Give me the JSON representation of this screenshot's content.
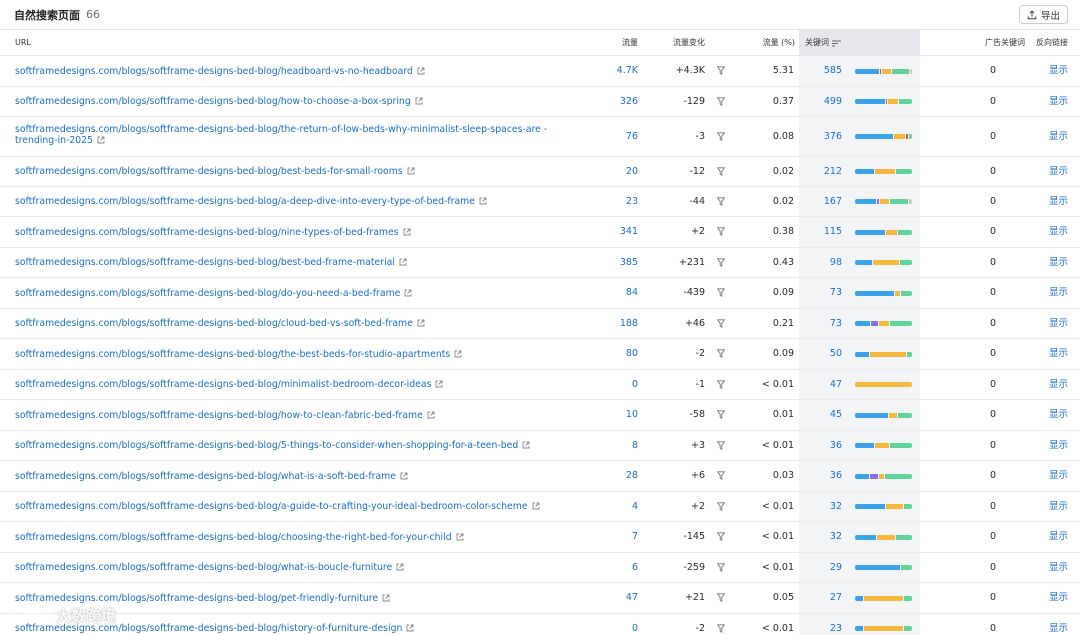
{
  "header": {
    "title": "自然搜索页面",
    "count": "66",
    "export_label": "导出"
  },
  "columns": {
    "url": "URL",
    "traffic": "流量",
    "change": "流量变化",
    "pct": "流量 (%)",
    "keywords": "关键词",
    "ad_keywords": "广告关键词",
    "backlinks": "反向链接"
  },
  "colors": {
    "blue": "#3aa3ea",
    "red": "#e24b4b",
    "orange": "#f4b93e",
    "green": "#5fd39a",
    "purple": "#8d6cf0",
    "gray": "#c8c8c8",
    "link": "#1a6fc4"
  },
  "rows": [
    {
      "url": "softframedesigns.com/blogs/softframe-designs-bed-blog/headboard-vs-no-headboard",
      "traffic": "4.7K",
      "change": "+4.3K",
      "pct": "5.31",
      "keywords": "585",
      "ad_keywords": "0",
      "backlinks": "显示",
      "bar": [
        [
          "blue",
          45
        ],
        [
          "red",
          3
        ],
        [
          "orange",
          17
        ],
        [
          "green",
          32
        ],
        [
          "gray",
          3
        ]
      ]
    },
    {
      "url": "softframedesigns.com/blogs/softframe-designs-bed-blog/how-to-choose-a-box-spring",
      "traffic": "326",
      "change": "-129",
      "pct": "0.37",
      "keywords": "499",
      "ad_keywords": "0",
      "backlinks": "显示",
      "bar": [
        [
          "blue",
          55
        ],
        [
          "red",
          3
        ],
        [
          "orange",
          17
        ],
        [
          "green",
          25
        ]
      ]
    },
    {
      "url": "softframedesigns.com/blogs/softframe-designs-bed-blog/the-return-of-low-beds-why-minimalist-sleep-spaces-are -trending-in-2025",
      "traffic": "76",
      "change": "-3",
      "pct": "0.08",
      "keywords": "376",
      "ad_keywords": "0",
      "backlinks": "显示",
      "bar": [
        [
          "blue",
          70
        ],
        [
          "orange",
          20
        ],
        [
          "red",
          4
        ],
        [
          "green",
          6
        ]
      ]
    },
    {
      "url": "softframedesigns.com/blogs/softframe-designs-bed-blog/best-beds-for-small-rooms",
      "traffic": "20",
      "change": "-12",
      "pct": "0.02",
      "keywords": "212",
      "ad_keywords": "0",
      "backlinks": "显示",
      "bar": [
        [
          "blue",
          35
        ],
        [
          "orange",
          35
        ],
        [
          "green",
          30
        ]
      ]
    },
    {
      "url": "softframedesigns.com/blogs/softframe-designs-bed-blog/a-deep-dive-into-every-type-of-bed-frame",
      "traffic": "23",
      "change": "-44",
      "pct": "0.02",
      "keywords": "167",
      "ad_keywords": "0",
      "backlinks": "显示",
      "bar": [
        [
          "blue",
          40
        ],
        [
          "purple",
          4
        ],
        [
          "orange",
          16
        ],
        [
          "green",
          35
        ],
        [
          "gray",
          5
        ]
      ]
    },
    {
      "url": "softframedesigns.com/blogs/softframe-designs-bed-blog/nine-types-of-bed-frames",
      "traffic": "341",
      "change": "+2",
      "pct": "0.38",
      "keywords": "115",
      "ad_keywords": "0",
      "backlinks": "显示",
      "bar": [
        [
          "blue",
          55
        ],
        [
          "orange",
          20
        ],
        [
          "green",
          25
        ]
      ]
    },
    {
      "url": "softframedesigns.com/blogs/softframe-designs-bed-blog/best-bed-frame-material",
      "traffic": "385",
      "change": "+231",
      "pct": "0.43",
      "keywords": "98",
      "ad_keywords": "0",
      "backlinks": "显示",
      "bar": [
        [
          "blue",
          30
        ],
        [
          "orange",
          48
        ],
        [
          "green",
          22
        ]
      ]
    },
    {
      "url": "softframedesigns.com/blogs/softframe-designs-bed-blog/do-you-need-a-bed-frame",
      "traffic": "84",
      "change": "-439",
      "pct": "0.09",
      "keywords": "73",
      "ad_keywords": "0",
      "backlinks": "显示",
      "bar": [
        [
          "blue",
          70
        ],
        [
          "orange",
          10
        ],
        [
          "green",
          20
        ]
      ]
    },
    {
      "url": "softframedesigns.com/blogs/softframe-designs-bed-blog/cloud-bed-vs-soft-bed-frame",
      "traffic": "188",
      "change": "+46",
      "pct": "0.21",
      "keywords": "73",
      "ad_keywords": "0",
      "backlinks": "显示",
      "bar": [
        [
          "blue",
          28
        ],
        [
          "purple",
          12
        ],
        [
          "orange",
          20
        ],
        [
          "green",
          40
        ]
      ]
    },
    {
      "url": "softframedesigns.com/blogs/softframe-designs-bed-blog/the-best-beds-for-studio-apartments",
      "traffic": "80",
      "change": "-2",
      "pct": "0.09",
      "keywords": "50",
      "ad_keywords": "0",
      "backlinks": "显示",
      "bar": [
        [
          "blue",
          25
        ],
        [
          "orange",
          65
        ],
        [
          "green",
          10
        ]
      ]
    },
    {
      "url": "softframedesigns.com/blogs/softframe-designs-bed-blog/minimalist-bedroom-decor-ideas",
      "traffic": "0",
      "change": "-1",
      "pct": "< 0.01",
      "keywords": "47",
      "ad_keywords": "0",
      "backlinks": "显示",
      "bar": [
        [
          "orange",
          100
        ]
      ]
    },
    {
      "url": "softframedesigns.com/blogs/softframe-designs-bed-blog/how-to-clean-fabric-bed-frame",
      "traffic": "10",
      "change": "-58",
      "pct": "0.01",
      "keywords": "45",
      "ad_keywords": "0",
      "backlinks": "显示",
      "bar": [
        [
          "blue",
          60
        ],
        [
          "orange",
          15
        ],
        [
          "green",
          25
        ]
      ]
    },
    {
      "url": "softframedesigns.com/blogs/softframe-designs-bed-blog/5-things-to-consider-when-shopping-for-a-teen-bed",
      "traffic": "8",
      "change": "+3",
      "pct": "< 0.01",
      "keywords": "36",
      "ad_keywords": "0",
      "backlinks": "显示",
      "bar": [
        [
          "blue",
          35
        ],
        [
          "orange",
          25
        ],
        [
          "green",
          40
        ]
      ]
    },
    {
      "url": "softframedesigns.com/blogs/softframe-designs-bed-blog/what-is-a-soft-bed-frame",
      "traffic": "28",
      "change": "+6",
      "pct": "0.03",
      "keywords": "36",
      "ad_keywords": "0",
      "backlinks": "显示",
      "bar": [
        [
          "blue",
          25
        ],
        [
          "purple",
          15
        ],
        [
          "orange",
          10
        ],
        [
          "green",
          50
        ]
      ]
    },
    {
      "url": "softframedesigns.com/blogs/softframe-designs-bed-blog/a-guide-to-crafting-your-ideal-bedroom-color-scheme",
      "traffic": "4",
      "change": "+2",
      "pct": "< 0.01",
      "keywords": "32",
      "ad_keywords": "0",
      "backlinks": "显示",
      "bar": [
        [
          "blue",
          55
        ],
        [
          "orange",
          30
        ],
        [
          "green",
          15
        ]
      ]
    },
    {
      "url": "softframedesigns.com/blogs/softframe-designs-bed-blog/choosing-the-right-bed-for-your-child",
      "traffic": "7",
      "change": "-145",
      "pct": "< 0.01",
      "keywords": "32",
      "ad_keywords": "0",
      "backlinks": "显示",
      "bar": [
        [
          "blue",
          38
        ],
        [
          "orange",
          32
        ],
        [
          "green",
          30
        ]
      ]
    },
    {
      "url": "softframedesigns.com/blogs/softframe-designs-bed-blog/what-is-boucle-furniture",
      "traffic": "6",
      "change": "-259",
      "pct": "< 0.01",
      "keywords": "29",
      "ad_keywords": "0",
      "backlinks": "显示",
      "bar": [
        [
          "blue",
          80
        ],
        [
          "green",
          20
        ]
      ]
    },
    {
      "url": "softframedesigns.com/blogs/softframe-designs-bed-blog/pet-friendly-furniture",
      "traffic": "47",
      "change": "+21",
      "pct": "0.05",
      "keywords": "27",
      "ad_keywords": "0",
      "backlinks": "显示",
      "bar": [
        [
          "blue",
          15
        ],
        [
          "orange",
          70
        ],
        [
          "green",
          15
        ]
      ]
    },
    {
      "url": "softframedesigns.com/blogs/softframe-designs-bed-blog/history-of-furniture-design",
      "traffic": "0",
      "change": "-2",
      "pct": "< 0.01",
      "keywords": "23",
      "ad_keywords": "0",
      "backlinks": "显示",
      "bar": [
        [
          "blue",
          15
        ],
        [
          "orange",
          70
        ],
        [
          "green",
          15
        ]
      ]
    }
  ],
  "watermark": {
    "text": "大数跨境"
  }
}
